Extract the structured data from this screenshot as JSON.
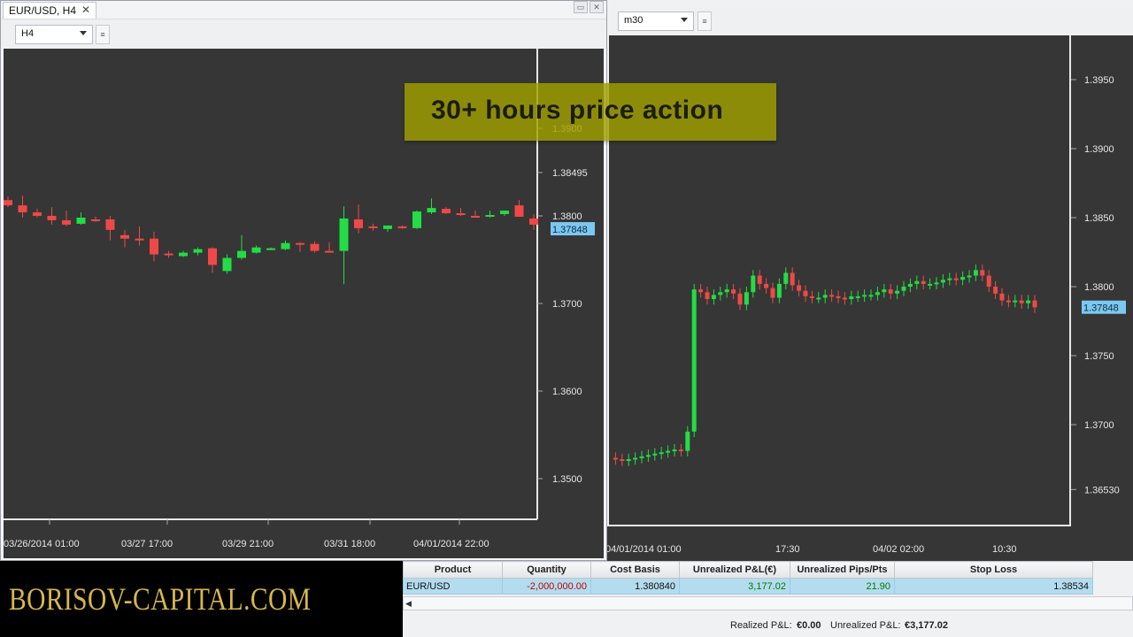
{
  "back_window": {
    "timeframe": "m30",
    "price_labels": [
      "1.3950",
      "1.3900",
      "1.3850",
      "1.3800",
      "1.3750",
      "1.3700",
      "1.36530"
    ],
    "current_price": "1.37848",
    "time_labels": [
      "04/01/2014 01:00",
      "17:30",
      "04/02 02:00",
      "10:30"
    ]
  },
  "front_window": {
    "tab_title": "EUR/USD, H4",
    "timeframe": "H4",
    "price_labels": [
      "1.3900",
      "1.38495",
      "1.3800",
      "1.3700",
      "1.3600",
      "1.3500"
    ],
    "current_price": "1.37848",
    "time_labels": [
      "03/26/2014 01:00",
      "03/27 17:00",
      "03/29 21:00",
      "03/31 18:00",
      "04/01/2014 22:00"
    ]
  },
  "banner": {
    "text": "30+ hours price action"
  },
  "logo": {
    "text": "BORISOV-CAPITAL.COM"
  },
  "positions": {
    "headers": [
      "Product",
      "Quantity",
      "Cost Basis",
      "Unrealized P&L(€)",
      "Unrealized Pips/Pts",
      "Stop Loss"
    ],
    "row": {
      "product": "EUR/USD",
      "quantity": "-2,000,000.00",
      "cost_basis": "1.380840",
      "pnl": "3,177.02",
      "pips": "21.90",
      "stop_loss": "1.38534"
    }
  },
  "status": {
    "realized_label": "Realized P&L:",
    "realized_value": "€0.00",
    "unrealized_label": "Unrealized P&L:",
    "unrealized_value": "€3,177.02"
  },
  "colors": {
    "bull": "#22dd44",
    "bear": "#f04848",
    "chart_bg": "#363636",
    "price_tag": "#7cc8f0",
    "banner": "#a0a000"
  },
  "chart_data": [
    {
      "type": "candlestick",
      "name": "",
      "timeframe": "H4",
      "ylim": [
        1.345,
        1.395
      ],
      "candles": [
        {
          "o": 1.3818,
          "h": 1.3822,
          "l": 1.381,
          "c": 1.3812,
          "dir": "down"
        },
        {
          "o": 1.3812,
          "h": 1.3823,
          "l": 1.3798,
          "c": 1.3804,
          "dir": "down"
        },
        {
          "o": 1.3804,
          "h": 1.3808,
          "l": 1.3798,
          "c": 1.38,
          "dir": "down"
        },
        {
          "o": 1.38,
          "h": 1.381,
          "l": 1.379,
          "c": 1.3795,
          "dir": "down"
        },
        {
          "o": 1.3795,
          "h": 1.3806,
          "l": 1.3788,
          "c": 1.379,
          "dir": "down"
        },
        {
          "o": 1.3791,
          "h": 1.3804,
          "l": 1.379,
          "c": 1.3798,
          "dir": "up"
        },
        {
          "o": 1.3795,
          "h": 1.3799,
          "l": 1.3793,
          "c": 1.3796,
          "dir": "down"
        },
        {
          "o": 1.3796,
          "h": 1.38,
          "l": 1.3772,
          "c": 1.3784,
          "dir": "down"
        },
        {
          "o": 1.3778,
          "h": 1.3784,
          "l": 1.3764,
          "c": 1.3774,
          "dir": "down"
        },
        {
          "o": 1.3774,
          "h": 1.3788,
          "l": 1.3766,
          "c": 1.3774,
          "dir": "down"
        },
        {
          "o": 1.3774,
          "h": 1.3782,
          "l": 1.3748,
          "c": 1.3756,
          "dir": "down"
        },
        {
          "o": 1.3757,
          "h": 1.376,
          "l": 1.3752,
          "c": 1.3756,
          "dir": "down"
        },
        {
          "o": 1.3754,
          "h": 1.376,
          "l": 1.3753,
          "c": 1.3758,
          "dir": "up"
        },
        {
          "o": 1.3758,
          "h": 1.3764,
          "l": 1.3755,
          "c": 1.3762,
          "dir": "up"
        },
        {
          "o": 1.3763,
          "h": 1.3764,
          "l": 1.3735,
          "c": 1.3744,
          "dir": "down"
        },
        {
          "o": 1.3737,
          "h": 1.3756,
          "l": 1.3734,
          "c": 1.3752,
          "dir": "up"
        },
        {
          "o": 1.3752,
          "h": 1.3778,
          "l": 1.375,
          "c": 1.376,
          "dir": "up"
        },
        {
          "o": 1.3758,
          "h": 1.3766,
          "l": 1.3757,
          "c": 1.3764,
          "dir": "up"
        },
        {
          "o": 1.3763,
          "h": 1.3764,
          "l": 1.3762,
          "c": 1.3763,
          "dir": "up"
        },
        {
          "o": 1.3762,
          "h": 1.3772,
          "l": 1.3761,
          "c": 1.3769,
          "dir": "up"
        },
        {
          "o": 1.3769,
          "h": 1.377,
          "l": 1.3759,
          "c": 1.3768,
          "dir": "down"
        },
        {
          "o": 1.3768,
          "h": 1.3771,
          "l": 1.3758,
          "c": 1.376,
          "dir": "down"
        },
        {
          "o": 1.376,
          "h": 1.377,
          "l": 1.3758,
          "c": 1.376,
          "dir": "down"
        },
        {
          "o": 1.376,
          "h": 1.3811,
          "l": 1.3722,
          "c": 1.3797,
          "dir": "up"
        },
        {
          "o": 1.3796,
          "h": 1.3813,
          "l": 1.378,
          "c": 1.3786,
          "dir": "down"
        },
        {
          "o": 1.3788,
          "h": 1.3791,
          "l": 1.3783,
          "c": 1.3786,
          "dir": "down"
        },
        {
          "o": 1.3785,
          "h": 1.3789,
          "l": 1.3782,
          "c": 1.3789,
          "dir": "up"
        },
        {
          "o": 1.3788,
          "h": 1.3789,
          "l": 1.3785,
          "c": 1.3787,
          "dir": "down"
        },
        {
          "o": 1.3786,
          "h": 1.3806,
          "l": 1.3785,
          "c": 1.3805,
          "dir": "up"
        },
        {
          "o": 1.3804,
          "h": 1.382,
          "l": 1.3802,
          "c": 1.3809,
          "dir": "up"
        },
        {
          "o": 1.3808,
          "h": 1.381,
          "l": 1.3802,
          "c": 1.3803,
          "dir": "down"
        },
        {
          "o": 1.3803,
          "h": 1.3809,
          "l": 1.38,
          "c": 1.3802,
          "dir": "down"
        },
        {
          "o": 1.38,
          "h": 1.3806,
          "l": 1.3798,
          "c": 1.38,
          "dir": "down"
        },
        {
          "o": 1.38,
          "h": 1.3806,
          "l": 1.3798,
          "c": 1.3801,
          "dir": "up"
        },
        {
          "o": 1.3802,
          "h": 1.3806,
          "l": 1.38,
          "c": 1.3806,
          "dir": "up"
        },
        {
          "o": 1.3812,
          "h": 1.3818,
          "l": 1.3805,
          "c": 1.3799,
          "dir": "down"
        },
        {
          "o": 1.3797,
          "h": 1.3802,
          "l": 1.3784,
          "c": 1.379,
          "dir": "down"
        }
      ]
    },
    {
      "type": "candlestick",
      "name": "",
      "timeframe": "m30",
      "ylim": [
        1.3638,
        1.3978
      ],
      "series_path": [
        1.3676,
        1.3675,
        1.3674,
        1.3675,
        1.3676,
        1.3677,
        1.3678,
        1.3679,
        1.368,
        1.3681,
        1.3682,
        1.3681,
        1.3695,
        1.3798,
        1.3796,
        1.3791,
        1.3794,
        1.3796,
        1.3798,
        1.3795,
        1.3787,
        1.3796,
        1.3808,
        1.3802,
        1.3799,
        1.3792,
        1.3802,
        1.381,
        1.3801,
        1.3797,
        1.3793,
        1.3792,
        1.3792,
        1.3794,
        1.3793,
        1.3792,
        1.3791,
        1.3793,
        1.3793,
        1.3794,
        1.3794,
        1.3796,
        1.3798,
        1.3795,
        1.3797,
        1.38,
        1.3802,
        1.3804,
        1.3802,
        1.3802,
        1.3803,
        1.3805,
        1.3806,
        1.3805,
        1.3807,
        1.3808,
        1.3812,
        1.3808,
        1.38,
        1.3795,
        1.379,
        1.3789,
        1.379,
        1.3788,
        1.379,
        1.3785
      ]
    }
  ]
}
